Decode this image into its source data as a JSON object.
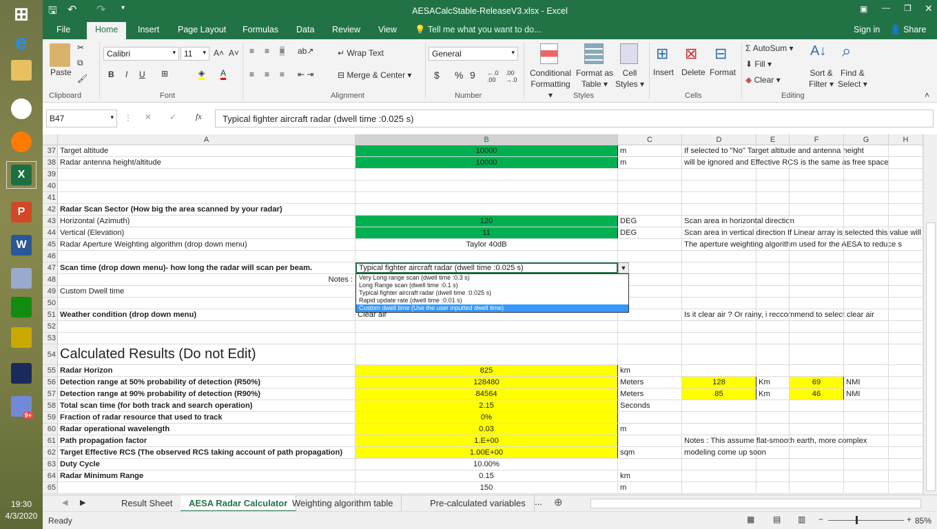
{
  "taskbar": {
    "icons": [
      "windows-start-icon",
      "internet-explorer-icon",
      "file-explorer-icon",
      "chrome-icon",
      "firefox-icon",
      "excel-icon",
      "powerpoint-icon",
      "word-icon",
      "paint-icon",
      "calculator-icon",
      "bird-app-icon",
      "nox-icon",
      "discord-icon"
    ],
    "discord_badge": "9+",
    "time": "19:30",
    "date": "4/3/2020"
  },
  "window": {
    "title": "AESACalcStable-ReleaseV3.xlsx - Excel"
  },
  "ribbon_tabs": [
    "File",
    "Home",
    "Insert",
    "Page Layout",
    "Formulas",
    "Data",
    "Review",
    "View"
  ],
  "active_tab": "Home",
  "tell_me": "Tell me what you want to do...",
  "sign_in": "Sign in",
  "share": "Share",
  "ribbon": {
    "clipboard": {
      "paste": "Paste",
      "label": "Clipboard"
    },
    "font": {
      "name": "Calibri",
      "size": "11",
      "label": "Font",
      "bold": "B",
      "italic": "I",
      "underline": "U"
    },
    "alignment": {
      "wrap": "Wrap Text",
      "merge": "Merge & Center",
      "label": "Alignment"
    },
    "number": {
      "format": "General",
      "label": "Number",
      "currency": "$",
      "percent": "%",
      "comma": "9"
    },
    "styles": {
      "conditional": "Conditional",
      "conditional2": "Formatting",
      "format_as": "Format as",
      "format_as2": "Table",
      "cell": "Cell",
      "cell2": "Styles",
      "label": "Styles"
    },
    "cells": {
      "insert": "Insert",
      "delete": "Delete",
      "format": "Format",
      "label": "Cells"
    },
    "editing": {
      "autosum": "AutoSum",
      "fill": "Fill",
      "clear": "Clear",
      "sort": "Sort &",
      "sort2": "Filter",
      "find": "Find &",
      "find2": "Select",
      "label": "Editing"
    }
  },
  "formula_bar": {
    "name_box": "B47",
    "fx": "fx",
    "value": "Typical fighter aircraft radar  (dwell time :0.025 s)"
  },
  "columns": [
    "A",
    "B",
    "C",
    "D",
    "E",
    "F",
    "G",
    "H"
  ],
  "rows": [
    {
      "n": "37",
      "A": "Target altitude",
      "B": "10000",
      "C": "m",
      "D": "If selected to \"No\" Target altitude and antenna height",
      "Bfill": "green"
    },
    {
      "n": "38",
      "A": "Radar antenna height/altitude",
      "B": "10000",
      "C": "m",
      "D": "will be ignored and Effective RCS is the same as free space",
      "Bfill": "green"
    },
    {
      "n": "39"
    },
    {
      "n": "40"
    },
    {
      "n": "41"
    },
    {
      "n": "42",
      "A": "Radar Scan Sector (How big the area scanned by your radar)",
      "Abold": true
    },
    {
      "n": "43",
      "A": "Horizontal (Azimuth)",
      "B": "120",
      "C": "DEG",
      "D": "Scan area in horizontal direction",
      "Bfill": "green"
    },
    {
      "n": "44",
      "A": "Vertical (Elevation)",
      "B": "11",
      "C": "DEG",
      "D": "Scan area in vertical direction If Linear array is selected this value will b",
      "Bfill": "green"
    },
    {
      "n": "45",
      "A": "Radar Aperture Weighting algorithm (drop down menu)",
      "B": "Taylor 40dB",
      "D": "The aperture weighting algorithm used for the AESA to reduce s"
    },
    {
      "n": "46"
    },
    {
      "n": "47",
      "A": "Scan time (drop down menu)- how long the radar will scan per beam.",
      "Abold": true,
      "B": "Typical fighter aircraft radar  (dwell time :0.025 s)",
      "Bleft": true
    },
    {
      "n": "48",
      "A": "Notes :",
      "Aright": true
    },
    {
      "n": "49",
      "A": "Custom Dwell time"
    },
    {
      "n": "50"
    },
    {
      "n": "51",
      "A": "Weather condition (drop down menu)",
      "Abold": true,
      "B": "Clear air",
      "Bleft": true,
      "D": "Is it clear air ? Or rainy, i reccommend to select clear air"
    },
    {
      "n": "52"
    },
    {
      "n": "53"
    },
    {
      "n": "54",
      "A": "Calculated Results (Do not Edit)",
      "Abig": true
    },
    {
      "n": "55",
      "A": "Radar Horizon",
      "Abold": true,
      "B": "825",
      "C": "km",
      "Bfill": "yellow"
    },
    {
      "n": "56",
      "A": "Detection range at 50% probability of detection (R50%)",
      "Abold": true,
      "B": "128480",
      "C": "Meters",
      "D": "128",
      "E": "Km",
      "F": "69",
      "G": "NMI",
      "Bfill": "yellow",
      "DFfill": "yellow"
    },
    {
      "n": "57",
      "A": "Detection range at 90% probability of detection (R90%)",
      "Abold": true,
      "B": "84564",
      "C": "Meters",
      "D": "85",
      "E": "Km",
      "F": "46",
      "G": "NMI",
      "Bfill": "yellow",
      "DFfill": "yellow"
    },
    {
      "n": "58",
      "A": "Total scan time (for both track and search operation)",
      "Abold": true,
      "B": "2.15",
      "C": "Seconds",
      "Bfill": "yellow"
    },
    {
      "n": "59",
      "A": "Fraction of radar resource that used to track",
      "Abold": true,
      "B": "0%",
      "Bfill": "yellow"
    },
    {
      "n": "60",
      "A": "Radar operational wavelength",
      "Abold": true,
      "B": "0.03",
      "C": "m",
      "Bfill": "yellow"
    },
    {
      "n": "61",
      "A": "Path propagation factor",
      "Abold": true,
      "B": "1.E+00",
      "D": "Notes : This assume flat-smooth earth, more complex",
      "Bfill": "yellow"
    },
    {
      "n": "62",
      "A": "Target Effective RCS (The observed RCS taking account of path propagation)",
      "Abold": true,
      "B": "1.00E+00",
      "C": "sqm",
      "D": "modeling come up soon",
      "Bfill": "yellow"
    },
    {
      "n": "63",
      "A": "Duty Cycle",
      "Abold": true,
      "B": "10.00%"
    },
    {
      "n": "64",
      "A": "Radar Minimum Range",
      "Abold": true,
      "B": "0.15",
      "C": "km"
    },
    {
      "n": "65",
      "B": "150",
      "C": "m"
    }
  ],
  "dropdown": {
    "options": [
      "Very Long range scan (dwell time :0.3 s)",
      "Long Range scan (dwell time :0.1 s)",
      "Typical fighter aircraft radar  (dwell time :0.025 s)",
      "Rapid update rate  (dwell time :0.01 s)",
      "Custom dwell time (Use the user inputted dwell time)"
    ],
    "highlighted": 4
  },
  "sheet_tabs": [
    "Result Sheet",
    "AESA Radar Calculator",
    "Weighting algorithm table",
    "Pre-calculated variables"
  ],
  "active_sheet": "AESA Radar Calculator",
  "more_tabs": "...",
  "status": {
    "ready": "Ready",
    "zoom": "85%"
  },
  "colors": {
    "excel_green": "#217346",
    "input_fill": "#00b050",
    "result_fill": "#ffff00",
    "dropdown_highlight": "#3399ff"
  }
}
